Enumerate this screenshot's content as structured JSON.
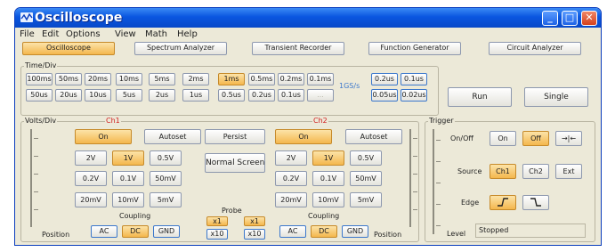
{
  "window": {
    "title": "Oscilloscope"
  },
  "titlebar": {
    "minimize": "_",
    "maximize": "□",
    "close": "✕"
  },
  "menu": [
    "File",
    "Edit",
    "Options",
    "View",
    "Math",
    "Help"
  ],
  "modes": [
    "Oscilloscope",
    "Spectrum Analyzer",
    "Transient Recorder",
    "Function Generator",
    "Circuit Analyzer"
  ],
  "timediv": {
    "label": "Time/Div",
    "row1": [
      "100ms",
      "50ms",
      "20ms",
      "10ms",
      "5ms",
      "2ms",
      "1ms",
      "0.5ms",
      "0.2ms",
      "0.1ms"
    ],
    "row2": [
      "50us",
      "20us",
      "10us",
      "5us",
      "2us",
      "1us",
      "0.5us",
      "0.2us",
      "0.1us",
      "..."
    ],
    "rate": "1GS/s",
    "fast_row1": [
      "0.2us",
      "0.1us"
    ],
    "fast_row2": [
      "0.05us",
      "0.02us"
    ]
  },
  "run": {
    "run": "Run",
    "single": "Single"
  },
  "volts": {
    "label": "Volts/Div",
    "ch1": "Ch1",
    "ch2": "Ch2",
    "on": "On",
    "autoset": "Autoset",
    "scale": [
      "2V",
      "1V",
      "0.5V",
      "0.2V",
      "0.1V",
      "50mV",
      "20mV",
      "10mV",
      "5mV"
    ],
    "persist": "Persist",
    "normal_screen": "Normal Screen",
    "probe": "Probe",
    "probe_options": [
      "x1",
      "x10"
    ],
    "coupling": "Coupling",
    "coupling_options": [
      "AC",
      "DC",
      "GND"
    ],
    "position": "Position"
  },
  "trigger": {
    "label": "Trigger",
    "onoff": "On/Off",
    "on": "On",
    "off": "Off",
    "arrows": "→|←",
    "source": "Source",
    "sources": [
      "Ch1",
      "Ch2",
      "Ext"
    ],
    "edge": "Edge",
    "level": "Level",
    "status": "Stopped"
  },
  "colors": {
    "titlebar": "#0a56e0",
    "selected": "#f4b74d",
    "window": "#ece9d8",
    "channel_label": "#d12020"
  }
}
